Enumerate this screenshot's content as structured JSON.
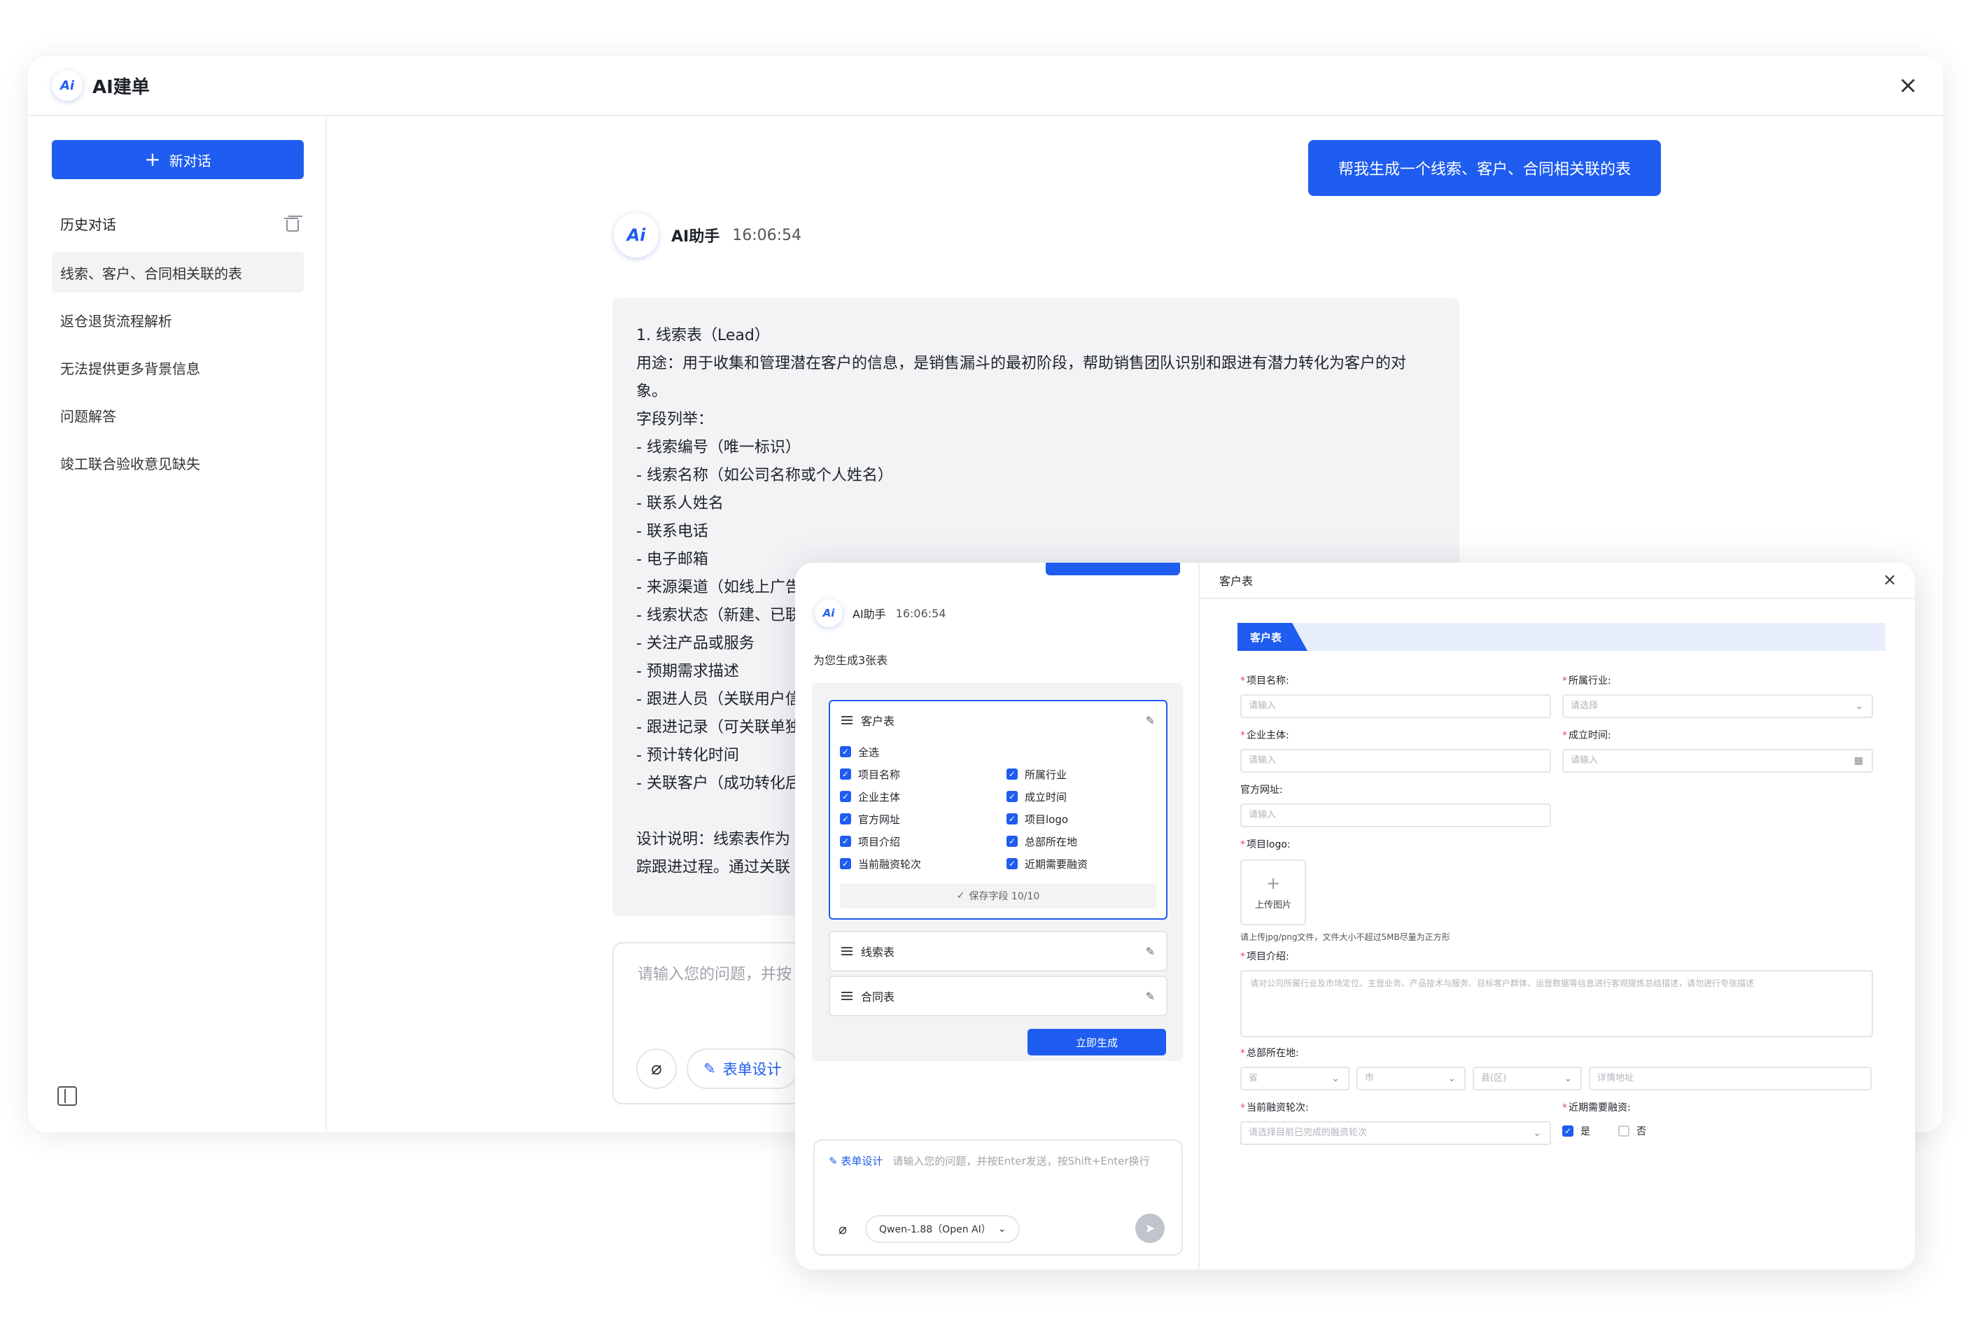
{
  "window": {
    "title": "AI建单",
    "logo_text": "Ai"
  },
  "sidebar": {
    "new_chat": "新对话",
    "history_title": "历史对话",
    "items": [
      {
        "label": "线索、客户、合同相关联的表"
      },
      {
        "label": "返仓退货流程解析"
      },
      {
        "label": "无法提供更多背景信息"
      },
      {
        "label": "问题解答"
      },
      {
        "label": "竣工联合验收意见缺失"
      }
    ]
  },
  "chat": {
    "user_message": "帮我生成一个线索、客户、合同相关联的表",
    "ai_name": "AI助手",
    "ai_time": "16:06:54",
    "answer_lines": [
      "1. 线索表（Lead）",
      "用途：用于收集和管理潜在客户的信息，是销售漏斗的最初阶段，帮助销售团队识别和跟进有潜力转化为客户的对",
      "象。",
      "字段列举：",
      "- 线索编号（唯一标识）",
      "- 线索名称（如公司名称或个人姓名）",
      "- 联系人姓名",
      "- 联系电话",
      "- 电子邮箱",
      "- 来源渠道（如线上广告",
      "- 线索状态（新建、已联",
      "- 关注产品或服务",
      "- 预期需求描述",
      "- 跟进人员（关联用户信",
      "- 跟进记录（可关联单独",
      "- 预计转化时间",
      "- 关联客户（成功转化后",
      "",
      "设计说明：线索表作为",
      "踪跟进过程。通过关联"
    ],
    "input_placeholder": "请输入您的问题，并按",
    "form_design": "表单设计"
  },
  "overlay": {
    "ai_name": "AI助手",
    "ai_time": "16:06:54",
    "generated_text": "为您生成3张表",
    "tables": [
      {
        "name": "客户表"
      },
      {
        "name": "线索表"
      },
      {
        "name": "合同表"
      }
    ],
    "select_all": "全选",
    "fields_left": [
      "项目名称",
      "企业主体",
      "官方网址",
      "项目介绍",
      "当前融资轮次"
    ],
    "fields_right": [
      "所属行业",
      "成立时间",
      "项目logo",
      "总部所在地",
      "近期需要融资"
    ],
    "save_fields": "保存字段 10/10",
    "generate_btn": "立即生成",
    "input_form_design": "表单设计",
    "input_placeholder": "请输入您的问题，并按Enter发送，按Shift+Enter换行",
    "model": "Qwen-1.88（Open AI）"
  },
  "form": {
    "panel_title": "客户表",
    "section_title": "客户表",
    "project_name_label": "项目名称:",
    "project_name_ph": "请输入",
    "industry_label": "所属行业:",
    "industry_ph": "请选择",
    "entity_label": "企业主体:",
    "entity_ph": "请输入",
    "founded_label": "成立时间:",
    "founded_ph": "请输入",
    "website_label": "官方网址:",
    "website_ph": "请输入",
    "logo_label": "项目logo:",
    "upload_text": "上传图片",
    "upload_hint": "请上传jpg/png文件，文件大小不超过5MB尽量为正方形",
    "intro_label": "项目介绍:",
    "intro_ph": "请对公司所属行业及市场定位、主营业务、产品技术与服务、目标客户群体、运营数据等信息进行客观提炼总结描述，请勿进行夸张描述",
    "hq_label": "总部所在地:",
    "hq_province": "省",
    "hq_city": "市",
    "hq_county": "县(区)",
    "hq_detail": "详情地址",
    "round_label": "当前融资轮次:",
    "round_ph": "请选择目前已完成的融资轮次",
    "need_label": "近期需要融资:",
    "yes": "是",
    "no": "否"
  }
}
